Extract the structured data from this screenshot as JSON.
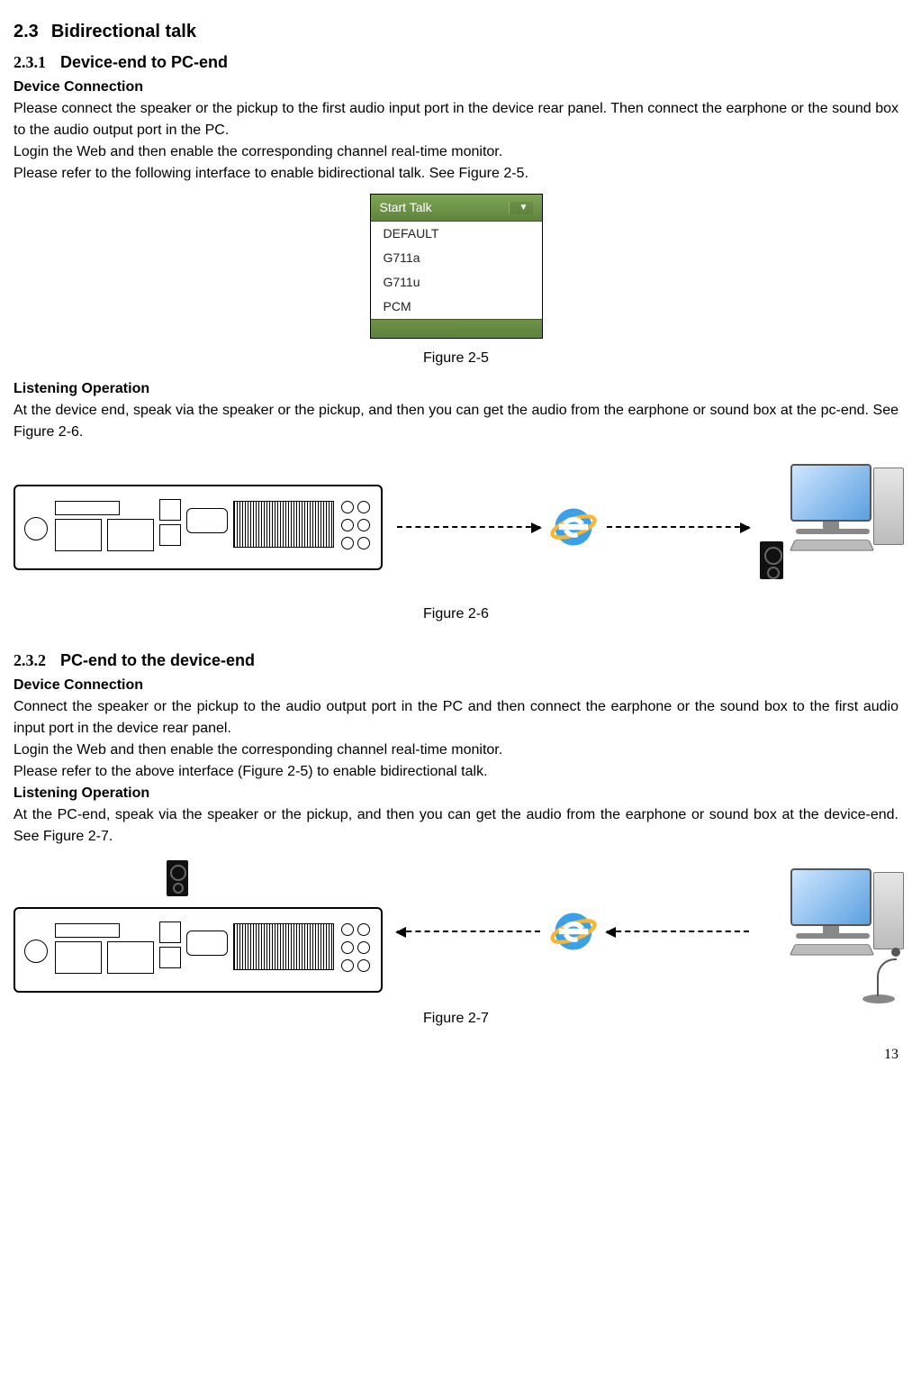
{
  "section": {
    "num": "2.3",
    "title": "Bidirectional talk",
    "sub1": {
      "num": "2.3.1",
      "title": "Device-end to PC-end",
      "h_device_conn": "Device Connection",
      "p1": "Please connect the speaker or the pickup to the first audio input port in the device rear panel. Then connect the earphone or the sound box to the audio output port in the PC.",
      "p2": "Login the Web and then enable the corresponding channel real-time monitor.",
      "p3": "Please refer to the following interface to enable bidirectional talk. See Figure 2-5.",
      "h_listening": "Listening Operation",
      "p4": "At the device end, speak via the speaker or the pickup, and then you can get the audio from the earphone or sound box at the pc-end. See Figure 2-6."
    },
    "sub2": {
      "num": "2.3.2",
      "title": "PC-end to the device-end",
      "h_device_conn": "Device Connection",
      "p1": "Connect the speaker or the pickup to the audio output port in the PC and then connect the earphone or the sound box to the first audio input port in the device rear panel.",
      "p2": "Login the Web and then enable the corresponding channel real-time monitor.",
      "p3": "Please refer to the above interface (Figure 2-5) to enable bidirectional talk.",
      "h_listening": "Listening Operation",
      "p4": "At the PC-end, speak via the speaker or the pickup, and then you can get the audio from the earphone or sound box at the device-end. See Figure 2-7."
    }
  },
  "figures": {
    "f25": {
      "caption": "Figure 2-5",
      "header": "Start Talk",
      "options": [
        "DEFAULT",
        "G711a",
        "G711u",
        "PCM"
      ]
    },
    "f26": {
      "caption": "Figure 2-6"
    },
    "f27": {
      "caption": "Figure 2-7"
    }
  },
  "page_number": "13"
}
